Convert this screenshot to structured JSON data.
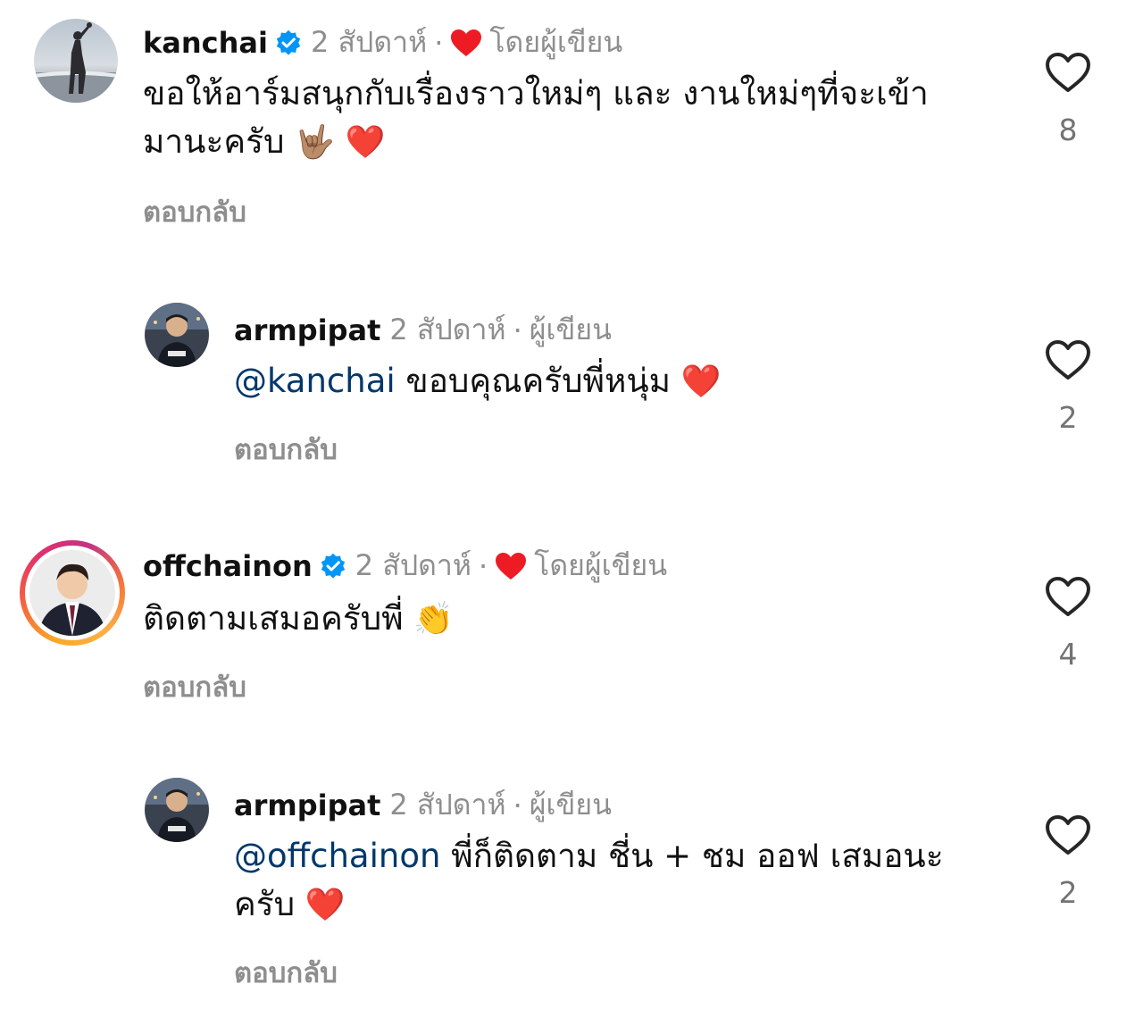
{
  "comments": [
    {
      "username": "kanchai",
      "verified": true,
      "time": "2 สัปดาห์",
      "separator": "·",
      "author_label": "โดยผู้เขียน",
      "text": "ขอให้อาร์มสนุกกับเรื่องราวใหม่ๆ และ งานใหม่ๆที่จะเข้ามานะครับ",
      "emojis": "🤟🏽 ❤️",
      "reply_label": "ตอบกลับ",
      "likes": "8",
      "avatar_icon": "profile-avatar"
    },
    {
      "username": "armpipat",
      "verified": false,
      "time": "2 สัปดาห์",
      "separator": "·",
      "author_label": "ผู้เขียน",
      "mention": "@kanchai",
      "text": "ขอบคุณครับพี่หนุ่ม",
      "emojis": "❤️",
      "reply_label": "ตอบกลับ",
      "likes": "2",
      "avatar_icon": "profile-avatar"
    },
    {
      "username": "offchainon",
      "verified": true,
      "time": "2 สัปดาห์",
      "separator": "·",
      "author_label": "โดยผู้เขียน",
      "text": "ติดตามเสมอครับพี่",
      "emojis": "👏",
      "reply_label": "ตอบกลับ",
      "likes": "4",
      "avatar_icon": "profile-avatar-story-ring"
    },
    {
      "username": "armpipat",
      "verified": false,
      "time": "2 สัปดาห์",
      "separator": "·",
      "author_label": "ผู้เขียน",
      "mention": "@offchainon",
      "text": "พี่ก็ติดตาม ชี่น + ชม ออฟ เสมอนะครับ",
      "emojis": "❤️",
      "reply_label": "ตอบกลับ",
      "likes": "2",
      "avatar_icon": "profile-avatar"
    }
  ],
  "colors": {
    "mention": "#00376b",
    "verified": "#0095f6",
    "heart": "#ed1c24",
    "secondary_text": "#8e8e8e"
  }
}
